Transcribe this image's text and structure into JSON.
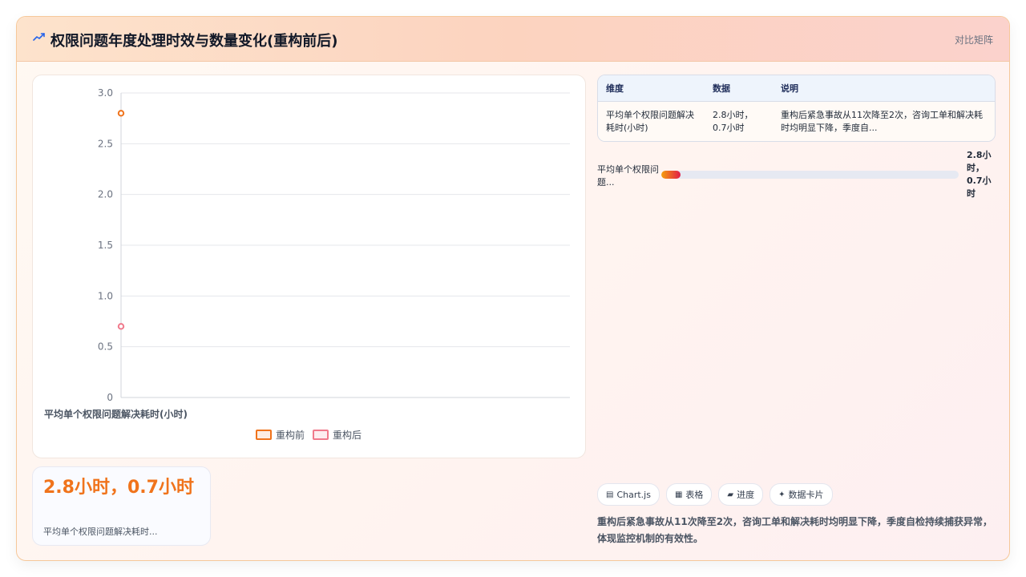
{
  "header": {
    "icon": "trend-icon",
    "title": "权限问题年度处理时效与数量变化(重构前后)",
    "action_label": "对比矩阵"
  },
  "chart_data": {
    "type": "scatter",
    "categories": [
      "平均单个权限问题解决耗时(小时)"
    ],
    "xlabel": "平均单个权限问题解决耗时(小时)",
    "ylim": [
      0,
      3.0
    ],
    "yticks": [
      "0",
      "0.5",
      "1.0",
      "1.5",
      "2.0",
      "2.5",
      "3.0"
    ],
    "series": [
      {
        "name": "重构前",
        "values": [
          2.8
        ],
        "color": "#f0731b"
      },
      {
        "name": "重构后",
        "values": [
          0.7
        ],
        "color": "#f07a8c"
      }
    ],
    "grid": true,
    "legend_position": "bottom"
  },
  "kpi": {
    "value": "2.8小时，0.7小时",
    "label": "平均单个权限问题解决耗时..."
  },
  "table": {
    "headers": [
      "维度",
      "数据",
      "说明"
    ],
    "rows": [
      [
        "平均单个权限问题解决耗时(小时)",
        "2.8小时，0.7小时",
        "重构后紧急事故从11次降至2次，咨询工单和解决耗时均明显下降，季度自..."
      ]
    ]
  },
  "progress": {
    "label": "平均单个权限问题...",
    "value": "2.8小时，0.7小时",
    "fill_fraction": 0.065
  },
  "chips": [
    {
      "icon": "chart-icon",
      "glyph": "▤",
      "label": "Chart.js"
    },
    {
      "icon": "table-icon",
      "glyph": "▦",
      "label": "表格"
    },
    {
      "icon": "progress-icon",
      "glyph": "▰",
      "label": "进度"
    },
    {
      "icon": "card-icon",
      "glyph": "✦",
      "label": "数据卡片"
    }
  ],
  "summary": "重构后紧急事故从11次降至2次，咨询工单和解决耗时均明显下降，季度自检持续捕获异常，体现监控机制的有效性。"
}
